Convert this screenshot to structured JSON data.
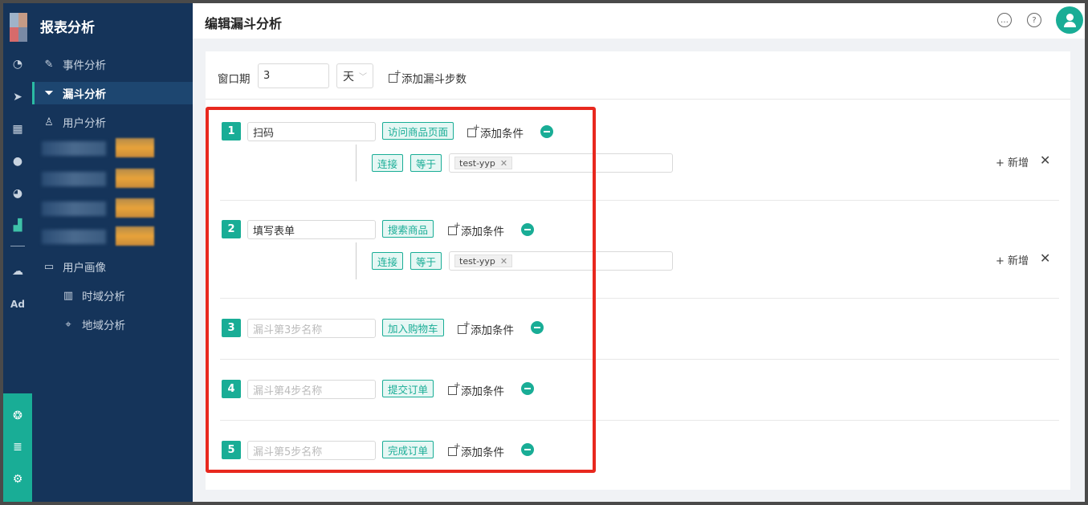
{
  "rail": {
    "icons": [
      "dashboard-icon",
      "send-icon",
      "layout-icon",
      "user-icon",
      "users-icon",
      "bar-chart-icon",
      "wechat-icon",
      "ad-icon"
    ],
    "ad_label": "Ad",
    "bottom_icons": [
      "network-icon",
      "server-icon",
      "gear-icon"
    ]
  },
  "menu": {
    "title": "报表分析",
    "items": [
      {
        "label": "事件分析",
        "icon": "edit-icon"
      },
      {
        "label": "漏斗分析",
        "icon": "funnel-icon"
      },
      {
        "label": "用户分析",
        "icon": "user-icon"
      },
      {
        "label": "用户画像",
        "icon": "folder-icon"
      },
      {
        "label": "时域分析",
        "icon": "bar-chart-icon"
      },
      {
        "label": "地域分析",
        "icon": "location-icon"
      }
    ]
  },
  "header": {
    "title": "编辑漏斗分析",
    "icons": [
      "message-icon",
      "help-icon"
    ]
  },
  "top_bar": {
    "window_label": "窗口期",
    "window_value": "3",
    "unit_value": "天",
    "add_step_label": "添加漏斗步数"
  },
  "steps": [
    {
      "num": "1",
      "name": "扫码",
      "placeholder": "",
      "event": "访问商品页面",
      "add_condition": "添加条件",
      "condition": {
        "prop": "连接",
        "op": "等于",
        "chip": "test-yyp",
        "add_new": "+ 新增",
        "close": "✕"
      }
    },
    {
      "num": "2",
      "name": "填写表单",
      "placeholder": "",
      "event": "搜索商品",
      "add_condition": "添加条件",
      "condition": {
        "prop": "连接",
        "op": "等于",
        "chip": "test-yyp",
        "add_new": "+ 新增",
        "close": "✕"
      }
    },
    {
      "num": "3",
      "name": "",
      "placeholder": "漏斗第3步名称",
      "event": "加入购物车",
      "add_condition": "添加条件"
    },
    {
      "num": "4",
      "name": "",
      "placeholder": "漏斗第4步名称",
      "event": "提交订单",
      "add_condition": "添加条件"
    },
    {
      "num": "5",
      "name": "",
      "placeholder": "漏斗第5步名称",
      "event": "完成订单",
      "add_condition": "添加条件"
    }
  ],
  "colors": {
    "accent": "#19ad96",
    "sidebar": "#15345a",
    "highlight": "#e8281e"
  }
}
